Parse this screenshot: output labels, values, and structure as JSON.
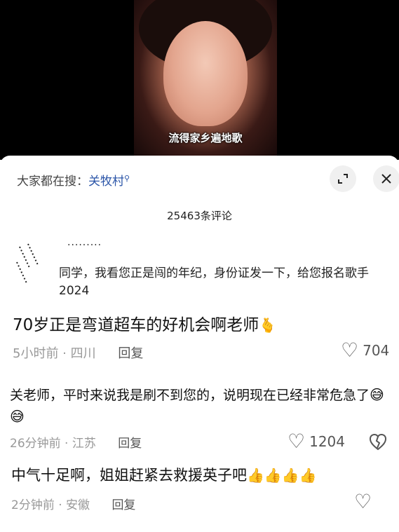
{
  "video": {
    "subtitle": "流得家乡遍地歌"
  },
  "panel": {
    "search_prefix": "大家都在搜：",
    "search_term": "关牧村",
    "search_icon": "search-icon",
    "comment_count": "25463条评论"
  },
  "comments": [
    {
      "quoted_text": "同学，我看您正是闯的年纪，身份证发一下，给您报名歌手2024",
      "text": "70岁正是弯道超车的好机会啊老师",
      "emoji": "🫰",
      "time_location": "5小时前 · 四川",
      "reply_label": "回复",
      "likes": "704"
    },
    {
      "text": "关老师，平时来说我是刷不到您的，说明现在已经非常危急了",
      "emoji": "😅😅",
      "time_location": "26分钟前 · 江苏",
      "reply_label": "回复",
      "likes": "1204"
    },
    {
      "text": "中气十足啊，姐姐赶紧去救援英子吧",
      "emoji": "👍👍👍👍",
      "time_location": "2分钟前 · 安徽",
      "reply_label": "回复"
    }
  ]
}
